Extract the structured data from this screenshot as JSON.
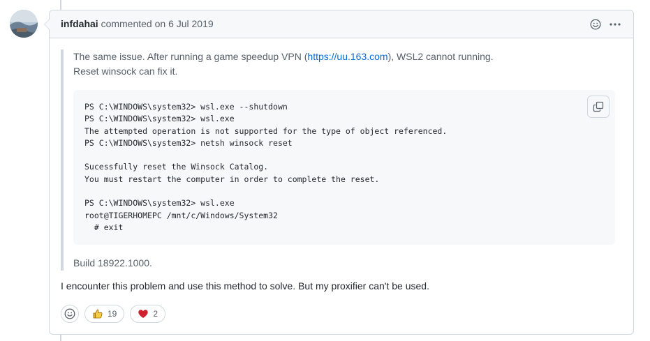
{
  "comment": {
    "author": "infdahai",
    "action": "commented on",
    "date": "6 Jul 2019"
  },
  "quote": {
    "line1_before": "The same issue. After running a game speedup VPN (",
    "link_text": "https://uu.163.com",
    "line1_after": "), WSL2 cannot running.",
    "line2": "Reset winsock can fix it.",
    "code": "PS C:\\WINDOWS\\system32> wsl.exe --shutdown\nPS C:\\WINDOWS\\system32> wsl.exe\nThe attempted operation is not supported for the type of object referenced.\nPS C:\\WINDOWS\\system32> netsh winsock reset\n\nSucessfully reset the Winsock Catalog.\nYou must restart the computer in order to complete the reset.\n\nPS C:\\WINDOWS\\system32> wsl.exe\nroot@TIGERHOMEPC /mnt/c/Windows/System32\n  # exit",
    "build": "Build 18922.1000."
  },
  "reply": "I encounter this problem and use this method to solve. But my proxifier can't be used.",
  "reactions": [
    {
      "icon": "thumbs-up-icon",
      "count": "19"
    },
    {
      "icon": "heart-icon",
      "count": "2"
    }
  ],
  "colors": {
    "link": "#0969da",
    "border": "#d0d7de",
    "heart": "#cf222e",
    "thumb": "#e3b341"
  }
}
